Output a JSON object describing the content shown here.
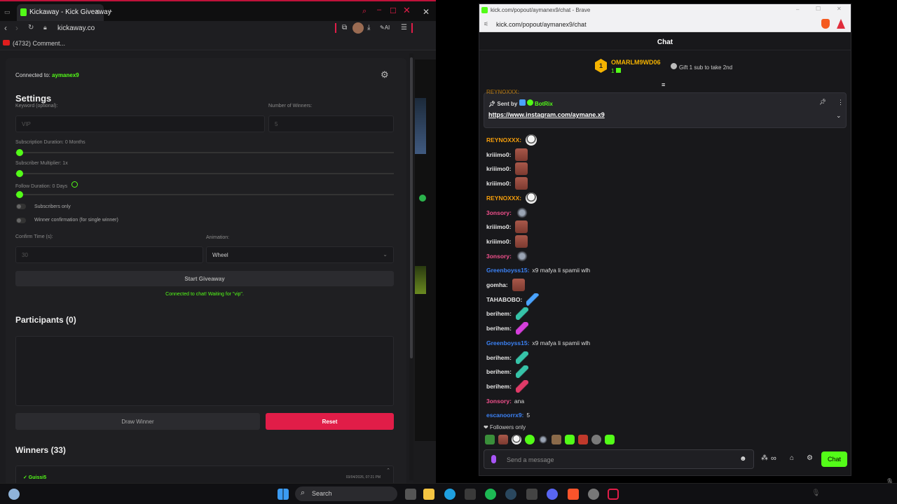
{
  "left_browser": {
    "tab_title": "Kickaway - Kick Giveaway",
    "url": "kickaway.co",
    "bookmark": "(4732) Comment...",
    "ai_label": "AI"
  },
  "giveaway": {
    "connected_label": "Connected to:",
    "connected_user": "aymanex9",
    "settings_title": "Settings",
    "keyword_label": "Keyword (optional):",
    "keyword_placeholder": "VIP",
    "winners_label": "Number of Winners:",
    "winners_placeholder": "5",
    "sub_duration_label": "Subscription Duration: 0 Months",
    "sub_multiplier_label": "Subscriber Multiplier: 1x",
    "follow_duration_label": "Follow Duration: 0 Days",
    "subscribers_only_label": "Subscribers only",
    "winner_confirm_label": "Winner confirmation (for single winner)",
    "confirm_time_label": "Confirm Time (s):",
    "confirm_time_placeholder": "30",
    "animation_label": "Animation:",
    "animation_value": "Wheel",
    "start_button": "Start Giveaway",
    "status_text": "Connected to chat! Waiting for \"vip\".",
    "participants_title": "Participants (0)",
    "draw_button": "Draw Winner",
    "reset_button": "Reset",
    "winners_title": "Winners (33)",
    "winner_entry": {
      "name": "✓ Guissi5",
      "time": "03/04/2026, 07:21 PM"
    },
    "accent_color": "#53fc18",
    "reset_color": "#e11d48"
  },
  "right_browser": {
    "window_title": "kick.com/popout/aymanex9/chat - Brave",
    "url": "kick.com/popout/aymanex9/chat",
    "chat_title": "Chat",
    "top_gifter": {
      "rank": "1",
      "name": "OMARLM9WD06",
      "count": "1",
      "hint": "Gift 1 sub to take 2nd"
    },
    "pinned": {
      "sent_by": "Sent by",
      "user": "BotRix",
      "link": "https://www.instagram.com/aymane.x9"
    },
    "cut_username": "REYNOXXX:",
    "messages": [
      {
        "user": "REYNOXXX:",
        "color": "#f59e0b",
        "text": "",
        "emote": "face"
      },
      {
        "user": "kriiimo0:",
        "color": "#e5e5e5",
        "text": "",
        "emote": "brick"
      },
      {
        "user": "kriiimo0:",
        "color": "#e5e5e5",
        "text": "",
        "emote": "brick"
      },
      {
        "user": "kriiimo0:",
        "color": "#e5e5e5",
        "text": "",
        "emote": "brick"
      },
      {
        "user": "REYNOXXX:",
        "color": "#f59e0b",
        "text": "",
        "emote": "face"
      },
      {
        "user": "3onsory:",
        "color": "#f0508c",
        "text": "",
        "emote": "bird"
      },
      {
        "user": "kriiimo0:",
        "color": "#e5e5e5",
        "text": "",
        "emote": "brick"
      },
      {
        "user": "kriiimo0:",
        "color": "#e5e5e5",
        "text": "",
        "emote": "brick"
      },
      {
        "user": "3onsory:",
        "color": "#f0508c",
        "text": "",
        "emote": "bird"
      },
      {
        "user": "Greenboyss15:",
        "color": "#3b82f6",
        "text": "x9 mafya li spamii wlh",
        "emote": ""
      },
      {
        "user": "gomha:",
        "color": "#e5e5e5",
        "text": "",
        "emote": "brick"
      },
      {
        "user": "TAHABOBO:",
        "color": "#e5e5e5",
        "text": "",
        "emote": "bow"
      },
      {
        "user": "berihem:",
        "color": "#e5e5e5",
        "text": "",
        "emote": "feather-g"
      },
      {
        "user": "berihem:",
        "color": "#e5e5e5",
        "text": "",
        "emote": "feather-p"
      },
      {
        "user": "Greenboyss15:",
        "color": "#3b82f6",
        "text": "x9 mafya li spamii wlh",
        "emote": ""
      },
      {
        "user": "berihem:",
        "color": "#e5e5e5",
        "text": "",
        "emote": "feather-g"
      },
      {
        "user": "berihem:",
        "color": "#e5e5e5",
        "text": "",
        "emote": "feather-g"
      },
      {
        "user": "berihem:",
        "color": "#e5e5e5",
        "text": "",
        "emote": "feather-r"
      },
      {
        "user": "3onsory:",
        "color": "#f0508c",
        "text": "ana",
        "emote": ""
      },
      {
        "user": "escanoorrx9:",
        "color": "#3b82f6",
        "text": "5",
        "emote": ""
      }
    ],
    "followers_only": "Followers only",
    "send_placeholder": "Send a message",
    "chat_button": "Chat"
  },
  "taskbar": {
    "search_placeholder": "Search"
  }
}
